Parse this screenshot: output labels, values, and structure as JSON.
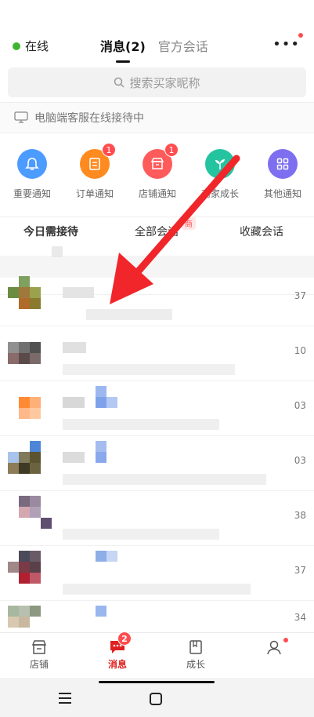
{
  "header": {
    "status_text": "在线",
    "tabs": [
      {
        "label": "消息(2)",
        "active": true
      },
      {
        "label": "官方会话",
        "active": false
      }
    ],
    "more_icon": "more-dots-icon"
  },
  "search": {
    "placeholder": "搜索买家昵称"
  },
  "pc_notice": {
    "text": "电脑端客服在线接待中"
  },
  "shortcuts": [
    {
      "label": "重要通知",
      "icon": "bell-icon",
      "color": "#4c9bff",
      "badge": ""
    },
    {
      "label": "订单通知",
      "icon": "order-icon",
      "color": "#ff8a1f",
      "badge": "1"
    },
    {
      "label": "店铺通知",
      "icon": "shop-icon",
      "color": "#ff5b5b",
      "badge": "1"
    },
    {
      "label": "商家成长",
      "icon": "sprout-icon",
      "color": "#24c4a0",
      "badge": ""
    },
    {
      "label": "其他通知",
      "icon": "grid-icon",
      "color": "#7d6ff0",
      "badge": ""
    }
  ],
  "subtabs": [
    {
      "label": "今日需接待"
    },
    {
      "label": "全部会话"
    },
    {
      "label": "收藏会话"
    }
  ],
  "subtab_promo": "商",
  "rows": [
    {
      "time": "37"
    },
    {
      "time": "10"
    },
    {
      "time": "03"
    },
    {
      "time": "03"
    },
    {
      "time": "38"
    },
    {
      "time": "37"
    },
    {
      "time": "34"
    }
  ],
  "bottom_nav": [
    {
      "label": "店铺",
      "icon": "store-icon",
      "active": false
    },
    {
      "label": "消息",
      "icon": "message-icon",
      "active": true,
      "badge": "2"
    },
    {
      "label": "成长",
      "icon": "book-icon",
      "active": false
    },
    {
      "label": "",
      "icon": "user-icon",
      "active": false,
      "dot": true
    }
  ],
  "colors": {
    "online": "#3fb52f",
    "accent": "#e02020",
    "badge": "#ff4d4f"
  }
}
